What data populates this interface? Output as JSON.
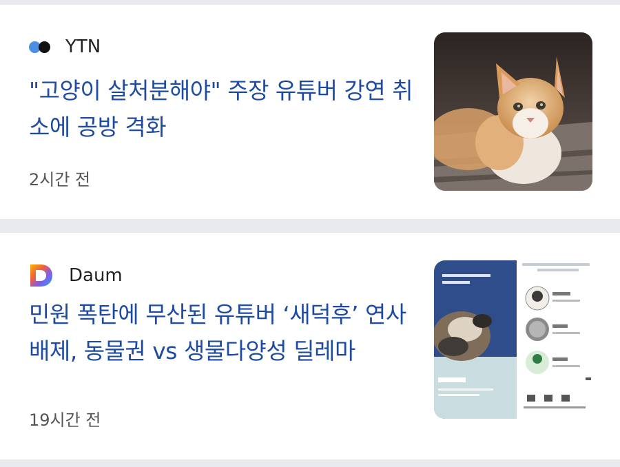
{
  "articles": [
    {
      "source": "YTN",
      "source_logo": "ytn-logo-icon",
      "headline": "\"고양이 살처분해야\" 주장 유튜버 강연 취소에 공방 격화",
      "time": "2시간 전",
      "thumbnail": "cat-photo"
    },
    {
      "source": "Daum",
      "source_logo": "daum-logo-icon",
      "headline": "민원 폭탄에 무산된 유튜버 ‘새덕후’ 연사 배제, 동물권 vs 생물다양성 딜레마",
      "time": "19시간 전",
      "thumbnail": "event-poster"
    }
  ],
  "colors": {
    "headline": "#1d4aa2",
    "background": "#e9eaee",
    "card": "#ffffff"
  }
}
